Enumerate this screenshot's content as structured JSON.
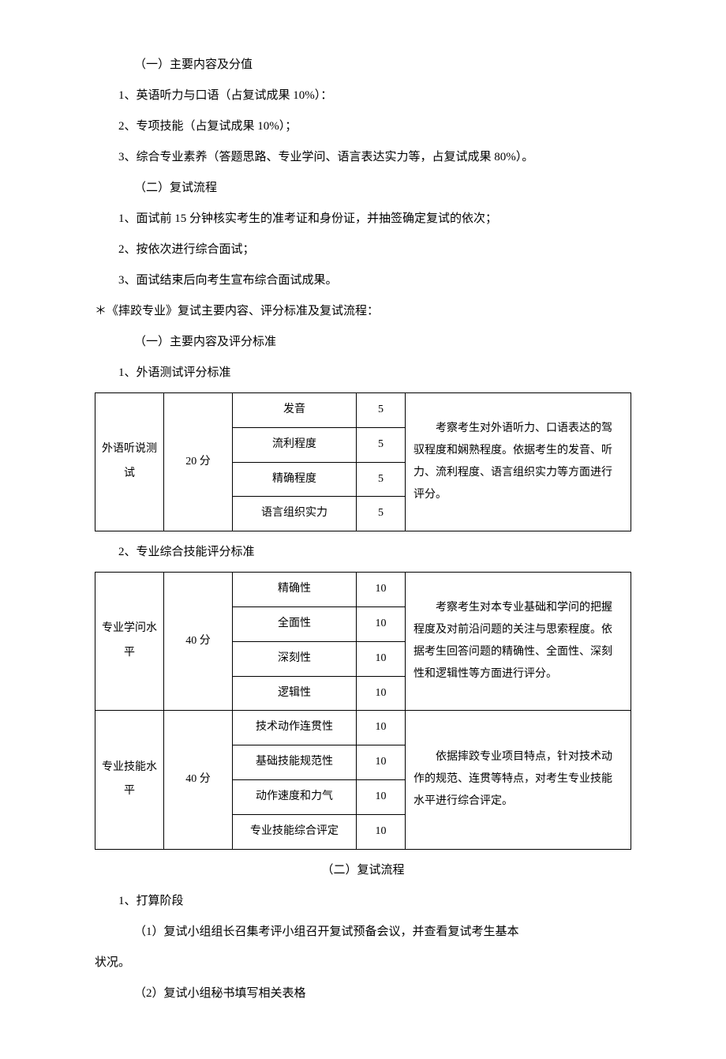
{
  "section1": {
    "title": "（一）主要内容及分值",
    "item1": "1、英语听力与口语（占复试成果 10%）：",
    "item2": "2、专项技能（占复试成果 10%）；",
    "item3": "3、综合专业素养（答题思路、专业学问、语言表达实力等，占复试成果 80%）。"
  },
  "section2": {
    "title": "（二）复试流程",
    "item1": "1、面试前 15 分钟核实考生的准考证和身份证，并抽签确定复试的依次；",
    "item2": "2、按依次进行综合面试；",
    "item3": "3、面试结束后向考生宣布综合面试成果。"
  },
  "star_heading": "＊《摔跤专业》复试主要内容、评分标准及复试流程：",
  "section3": {
    "title": "（一）主要内容及评分标准",
    "sub1": "1、外语测试评分标准",
    "sub2": "2、专业综合技能评分标准"
  },
  "table1": {
    "rowlabel": "外语听说测试",
    "score": "20 分",
    "rows": [
      {
        "crit": "发音",
        "pts": "5"
      },
      {
        "crit": "流利程度",
        "pts": "5"
      },
      {
        "crit": "精确程度",
        "pts": "5"
      },
      {
        "crit": "语言组织实力",
        "pts": "5"
      }
    ],
    "desc": "　　考察考生对外语听力、口语表达的驾驭程度和娴熟程度。依据考生的发音、听力、流利程度、语言组织实力等方面进行评分。"
  },
  "table2": {
    "group1": {
      "rowlabel": "专业学问水平",
      "score": "40 分",
      "rows": [
        {
          "crit": "精确性",
          "pts": "10"
        },
        {
          "crit": "全面性",
          "pts": "10"
        },
        {
          "crit": "深刻性",
          "pts": "10"
        },
        {
          "crit": "逻辑性",
          "pts": "10"
        }
      ],
      "desc": "　　考察考生对本专业基础和学问的把握程度及对前沿问题的关注与思索程度。依据考生回答问题的精确性、全面性、深刻性和逻辑性等方面进行评分。"
    },
    "group2": {
      "rowlabel": "专业技能水平",
      "score": "40 分",
      "rows": [
        {
          "crit": "技术动作连贯性",
          "pts": "10"
        },
        {
          "crit": "基础技能规范性",
          "pts": "10"
        },
        {
          "crit": "动作速度和力气",
          "pts": "10"
        },
        {
          "crit": "专业技能综合评定",
          "pts": "10"
        }
      ],
      "desc": "　　依据摔跤专业项目特点，针对技术动作的规范、连贯等特点，对考生专业技能水平进行综合评定。"
    }
  },
  "section4": {
    "title": "（二）复试流程",
    "item1": "1、打算阶段",
    "sub1": "（1）复试小组组长召集考评小组召开复试预备会议，并查看复试考生基本",
    "sub1_cont": "状况。",
    "sub2": "（2）复试小组秘书填写相关表格"
  }
}
